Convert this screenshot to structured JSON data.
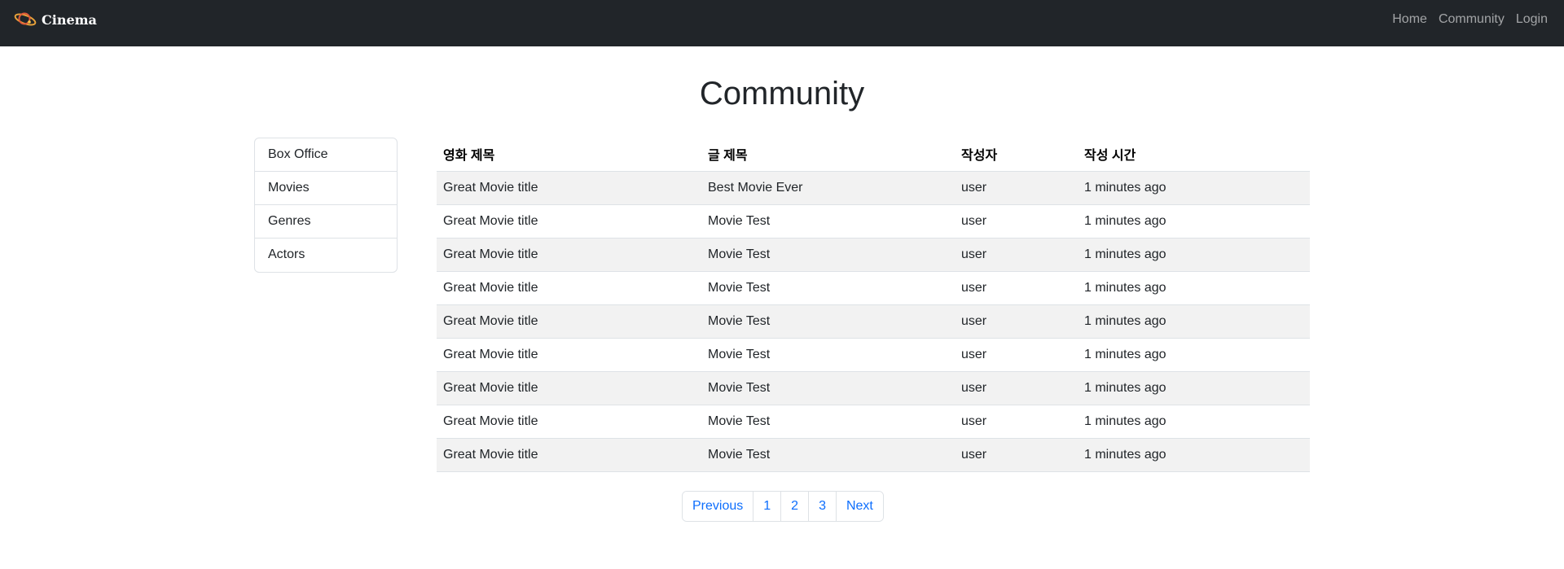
{
  "navbar": {
    "brand": "Cinema",
    "brand_icon": "planet-icon",
    "links": [
      "Home",
      "Community",
      "Login"
    ]
  },
  "page": {
    "title": "Community"
  },
  "sidebar": {
    "items": [
      "Box Office",
      "Movies",
      "Genres",
      "Actors"
    ]
  },
  "table": {
    "headers": [
      "영화 제목",
      "글 제목",
      "작성자",
      "작성 시간"
    ],
    "rows": [
      [
        "Great Movie title",
        "Best Movie Ever",
        "user",
        "1 minutes ago"
      ],
      [
        "Great Movie title",
        "Movie Test",
        "user",
        "1 minutes ago"
      ],
      [
        "Great Movie title",
        "Movie Test",
        "user",
        "1 minutes ago"
      ],
      [
        "Great Movie title",
        "Movie Test",
        "user",
        "1 minutes ago"
      ],
      [
        "Great Movie title",
        "Movie Test",
        "user",
        "1 minutes ago"
      ],
      [
        "Great Movie title",
        "Movie Test",
        "user",
        "1 minutes ago"
      ],
      [
        "Great Movie title",
        "Movie Test",
        "user",
        "1 minutes ago"
      ],
      [
        "Great Movie title",
        "Movie Test",
        "user",
        "1 minutes ago"
      ],
      [
        "Great Movie title",
        "Movie Test",
        "user",
        "1 minutes ago"
      ]
    ]
  },
  "pagination": {
    "previous": "Previous",
    "pages": [
      "1",
      "2",
      "3"
    ],
    "next": "Next"
  },
  "colors": {
    "navbar_bg": "#212529",
    "link_blue": "#0d6efd",
    "stripe": "#f2f2f2",
    "border": "#dee2e6"
  }
}
